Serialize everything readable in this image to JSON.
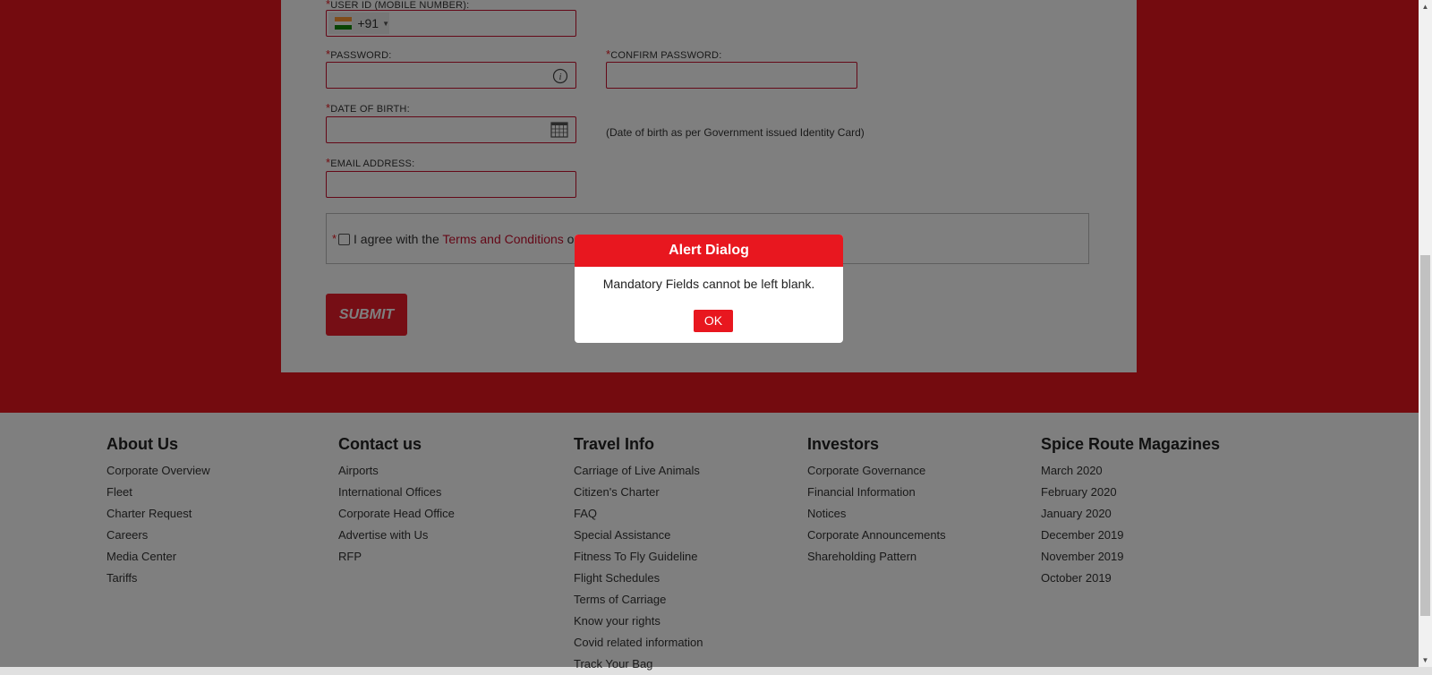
{
  "form": {
    "user_id_label": "USER ID (MOBILE NUMBER):",
    "country_code": "+91",
    "password_label": "PASSWORD:",
    "confirm_password_label": "CONFIRM PASSWORD:",
    "dob_label": "DATE OF BIRTH:",
    "dob_hint": "(Date of birth as per Government issued Identity Card)",
    "email_label": "EMAIL ADDRESS:",
    "required_marker": "*",
    "terms_prefix": "I agree with the ",
    "terms_link": "Terms and Conditions",
    "terms_suffix": " o",
    "submit_label": "SUBMIT"
  },
  "footer": {
    "columns": [
      {
        "heading": "About Us",
        "links": [
          "Corporate Overview",
          "Fleet",
          "Charter Request",
          "Careers",
          "Media Center",
          "Tariffs"
        ]
      },
      {
        "heading": "Contact us",
        "links": [
          "Airports",
          "International Offices",
          "Corporate Head Office",
          "Advertise with Us",
          "RFP"
        ]
      },
      {
        "heading": "Travel Info",
        "links": [
          "Carriage of Live Animals",
          "Citizen's Charter",
          "FAQ",
          "Special Assistance",
          "Fitness To Fly Guideline",
          "Flight Schedules",
          "Terms of Carriage",
          "Know your rights",
          "Covid related information",
          "Track Your Bag"
        ]
      },
      {
        "heading": "Investors",
        "links": [
          "Corporate Governance",
          "Financial Information",
          "Notices",
          "Corporate Announcements",
          "Shareholding Pattern"
        ]
      },
      {
        "heading": "Spice Route Magazines",
        "links": [
          "March 2020",
          "February 2020",
          "January 2020",
          "December 2019",
          "November 2019",
          "October 2019"
        ]
      }
    ]
  },
  "dialog": {
    "title": "Alert Dialog",
    "message": "Mandatory Fields cannot be left blank.",
    "ok_label": "OK"
  },
  "colors": {
    "brand_red": "#e8171f",
    "field_border": "#c8102e"
  },
  "icons": [
    "india-flag-icon",
    "info-icon",
    "calendar-icon",
    "checkbox-icon",
    "scroll-up-arrow-icon",
    "scroll-down-arrow-icon"
  ]
}
